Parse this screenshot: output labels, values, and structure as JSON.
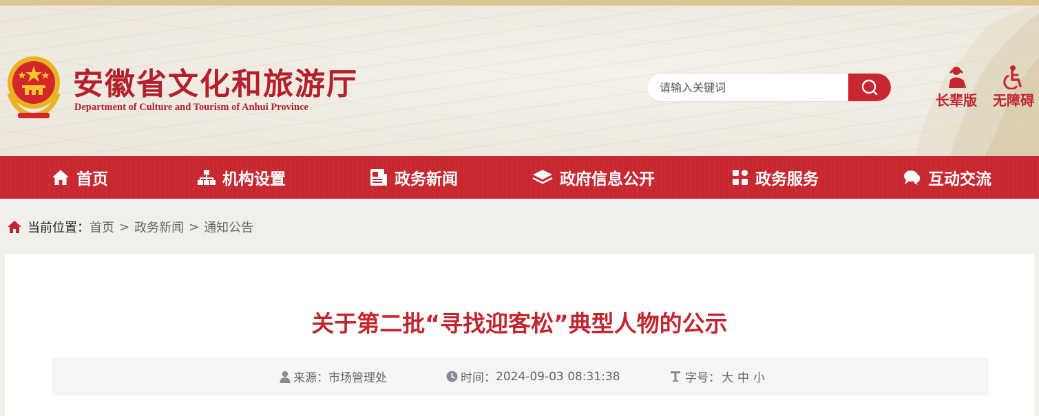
{
  "header": {
    "title": "安徽省文化和旅游厅",
    "subtitle": "Department of Culture and Tourism of Anhui Province",
    "search_placeholder": "请输入关键词",
    "tools": [
      {
        "label": "长辈版",
        "icon": "elder-icon"
      },
      {
        "label": "无障碍",
        "icon": "accessibility-icon"
      }
    ]
  },
  "nav": {
    "items": [
      {
        "label": "首页",
        "icon": "home-icon"
      },
      {
        "label": "机构设置",
        "icon": "org-chart-icon"
      },
      {
        "label": "政务新闻",
        "icon": "news-icon"
      },
      {
        "label": "政府信息公开",
        "icon": "layers-icon"
      },
      {
        "label": "政务服务",
        "icon": "grid-icon"
      },
      {
        "label": "互动交流",
        "icon": "chat-icon"
      }
    ]
  },
  "breadcrumb": {
    "label": "当前位置：",
    "items": [
      "首页",
      "政务新闻",
      "通知公告"
    ],
    "separator": ">"
  },
  "article": {
    "title": "关于第二批“寻找迎客松”典型人物的公示",
    "source_label": "来源：",
    "source_value": "市场管理处",
    "time_label": "时间：",
    "time_value": "2024-09-03 08:31:38",
    "font_size_label": "字号：",
    "font_sizes": [
      "大",
      "中",
      "小"
    ]
  },
  "colors": {
    "brand_red": "#c8272f",
    "title_red": "#b4202a",
    "top_strip": "#dcc48f"
  }
}
